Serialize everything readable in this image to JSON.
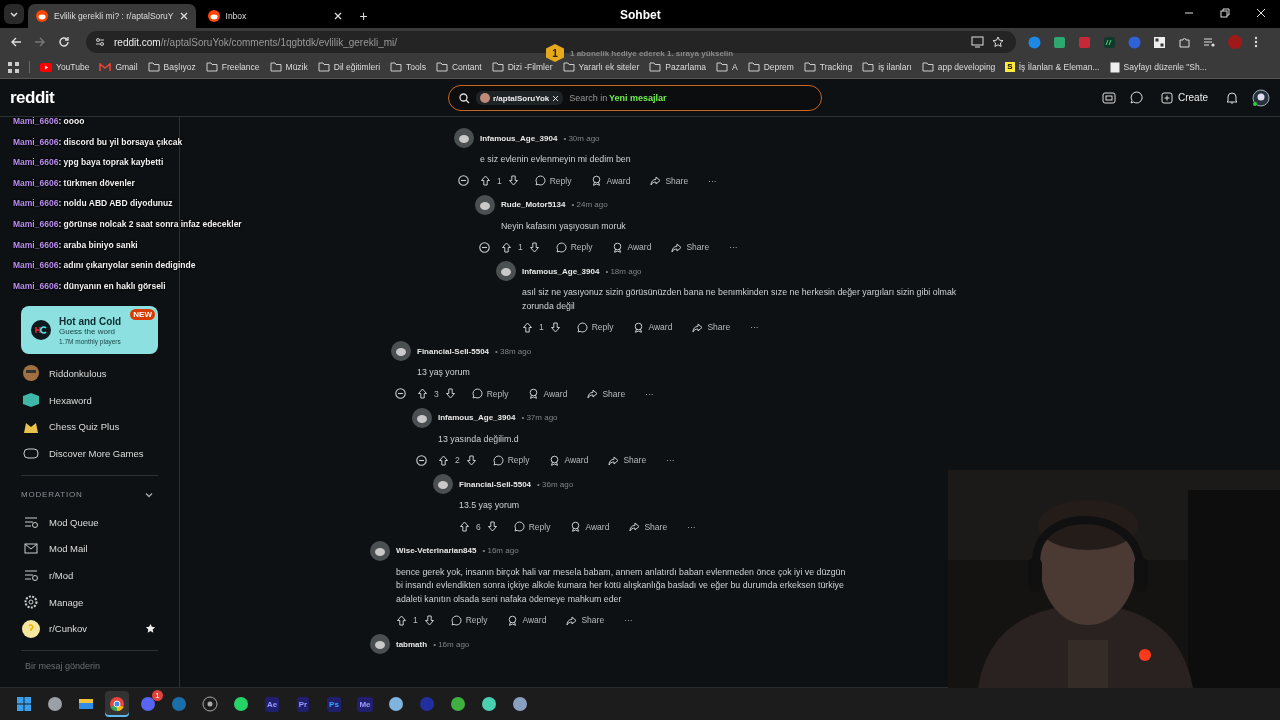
{
  "browser": {
    "tabs": [
      {
        "title": "Evlilik gerekli mi? : r/aptalSoruY",
        "selected": true
      },
      {
        "title": "Inbox",
        "selected": false
      }
    ],
    "new_tab": "+",
    "window_title": "Sohbet",
    "url": {
      "host": "reddit.com",
      "path": "/r/aptalSoruYok/comments/1qgbtdk/evlilik_gerekli_mi/"
    },
    "notification": {
      "badge": "1",
      "text": "1 abonelik hediye ederek 1. sıraya yükselin"
    },
    "bookmarks": [
      {
        "kind": "youtube",
        "label": "YouTube"
      },
      {
        "kind": "gmail",
        "label": "Gmail"
      },
      {
        "kind": "folder",
        "label": "Başlıyoz"
      },
      {
        "kind": "folder",
        "label": "Freelance"
      },
      {
        "kind": "folder",
        "label": "Müzik"
      },
      {
        "kind": "folder",
        "label": "Dil eğitimleri"
      },
      {
        "kind": "folder",
        "label": "Tools"
      },
      {
        "kind": "folder",
        "label": "Contant"
      },
      {
        "kind": "folder",
        "label": "Dizi -Filmler"
      },
      {
        "kind": "folder",
        "label": "Yararlı ek siteler"
      },
      {
        "kind": "folder",
        "label": "Pazarlama"
      },
      {
        "kind": "folder",
        "label": "A"
      },
      {
        "kind": "folder",
        "label": "Deprem"
      },
      {
        "kind": "folder",
        "label": "Tracking"
      },
      {
        "kind": "folder",
        "label": "iş ilanları"
      },
      {
        "kind": "folder",
        "label": "app developing"
      },
      {
        "kind": "letter",
        "icon_text": "S",
        "label": "İş İlanları & Eleman..."
      },
      {
        "kind": "page",
        "label": "Sayfayı düzenle \"Sh..."
      }
    ]
  },
  "header": {
    "logo": "reddit",
    "search": {
      "community": "r/aptalSoruYok",
      "placeholder": "Search in",
      "overlay": "Yeni mesajlar"
    },
    "create": "Create"
  },
  "chat_overlay": [
    {
      "user": "Mami_6606",
      "text": ": oooo"
    },
    {
      "user": "Mami_6606",
      "text": ": discord bu yil borsaya çıkcak"
    },
    {
      "user": "Mami_6606",
      "text": ": ypg baya toprak kaybetti"
    },
    {
      "user": "Mami_6606",
      "text": ": türkmen dövenler"
    },
    {
      "user": "Mami_6606",
      "text": ": noldu ABD ABD diyodunuz"
    },
    {
      "user": "Mami_6606",
      "text": ": görünse nolcak 2 saat sonra infaz edecekler"
    },
    {
      "user": "Mami_6606",
      "text": ": araba biniyo sanki"
    },
    {
      "user": "Mami_6606",
      "text": ": adını çıkarıyolar senin dediginde"
    },
    {
      "user": "Mami_6606",
      "text": ": dünyanın en haklı görseli"
    }
  ],
  "chat_input": {
    "placeholder": "Bir mesaj gönderin"
  },
  "sidebar": {
    "featured_game": {
      "title": "Hot and Cold",
      "subtitle": "Guess the word",
      "players": "1.7M monthly players",
      "badge": "NEW"
    },
    "games": [
      {
        "kind": "riddle",
        "label": "Riddonkulous"
      },
      {
        "kind": "hexa",
        "label": "Hexaword"
      },
      {
        "kind": "chess",
        "label": "Chess Quiz Plus"
      },
      {
        "kind": "controller",
        "label": "Discover More Games"
      }
    ],
    "moderation": {
      "title": "MODERATION",
      "expanded": true,
      "items": [
        {
          "kind": "queue",
          "label": "Mod Queue"
        },
        {
          "kind": "mail",
          "label": "Mod Mail"
        },
        {
          "kind": "queue",
          "label": "r/Mod"
        },
        {
          "kind": "gear",
          "label": "Manage"
        },
        {
          "kind": "community",
          "label": "r/Cunkov",
          "favorite": true
        }
      ]
    }
  },
  "comments": [
    {
      "author": "Infamous_Age_3904",
      "time": "• 30m ago",
      "body": "e siz evlenin evlenmeyin mi dedim ben",
      "votes": "1",
      "actions": [
        "Reply",
        "Award",
        "Share",
        "···"
      ],
      "children": [
        {
          "author": "Rude_Motor5134",
          "time": "• 24m ago",
          "body": "Neyin kafasını yaşıyosun moruk",
          "votes": "1",
          "actions": [
            "Reply",
            "Award",
            "Share",
            "···"
          ],
          "children": [
            {
              "author": "Infamous_Age_3904",
              "time": "• 18m ago",
              "body": "asıl siz ne yasıyonuz sizin görüsünüzden bana ne benımkinden sıze ne herkesin değer yargıları sizin gibi olmak zorunda değil",
              "votes": "1",
              "actions": [
                "Reply",
                "Award",
                "Share",
                "···"
              ]
            }
          ]
        }
      ]
    },
    {
      "author": "Financial-Sell-5504",
      "time": "• 38m ago",
      "body": "13 yaş yorum",
      "votes": "3",
      "actions": [
        "Reply",
        "Award",
        "Share",
        "···"
      ],
      "children": [
        {
          "author": "Infamous_Age_3904",
          "time": "• 37m ago",
          "body": "13 yasında değilim.d",
          "votes": "2",
          "actions": [
            "Reply",
            "Award",
            "Share",
            "···"
          ],
          "children": [
            {
              "author": "Financial-Sell-5504",
              "time": "• 36m ago",
              "body": "13.5 yaş yorum",
              "votes": "6",
              "actions": [
                "Reply",
                "Award",
                "Share",
                "···"
              ]
            }
          ]
        }
      ]
    },
    {
      "author": "Wise-Veterinarian845",
      "time": "• 16m ago",
      "body": "bence gerek yok, insanın birçok hali var mesela babam, annem anlatırdı baban evlenmeden önce çok iyi ve düzgün bi insandı evlendikten sonra içkiye alkole kumara her kötü alışkanlığa basladı ve eğer bu durumda erkeksen türkiye adaleti kanıtın olsada seni nafaka ödemeye mahkum eder",
      "votes": "1",
      "actions": [
        "Reply",
        "Award",
        "Share",
        "···"
      ]
    },
    {
      "author": "tabmath",
      "time": "• 16m ago"
    }
  ],
  "taskbar": [
    {
      "kind": "start",
      "active": false
    },
    {
      "kind": "taskview",
      "active": false
    },
    {
      "kind": "files",
      "active": false
    },
    {
      "kind": "chrome",
      "active": true
    },
    {
      "kind": "discord",
      "badge": "1",
      "active": false
    },
    {
      "kind": "steam",
      "active": false
    },
    {
      "kind": "obs",
      "active": false
    },
    {
      "kind": "whatsapp",
      "active": false
    },
    {
      "kind": "adobe",
      "label": "Ae",
      "active": false
    },
    {
      "kind": "adobe",
      "label": "Pr",
      "active": false
    },
    {
      "kind": "adobe",
      "label": "Ps",
      "active": false
    },
    {
      "kind": "adobe",
      "label": "Me",
      "active": false
    },
    {
      "kind": "gem",
      "active": false
    },
    {
      "kind": "burger",
      "active": false
    },
    {
      "kind": "hook",
      "active": false
    },
    {
      "kind": "robot",
      "active": false
    },
    {
      "kind": "gear",
      "active": false
    }
  ]
}
